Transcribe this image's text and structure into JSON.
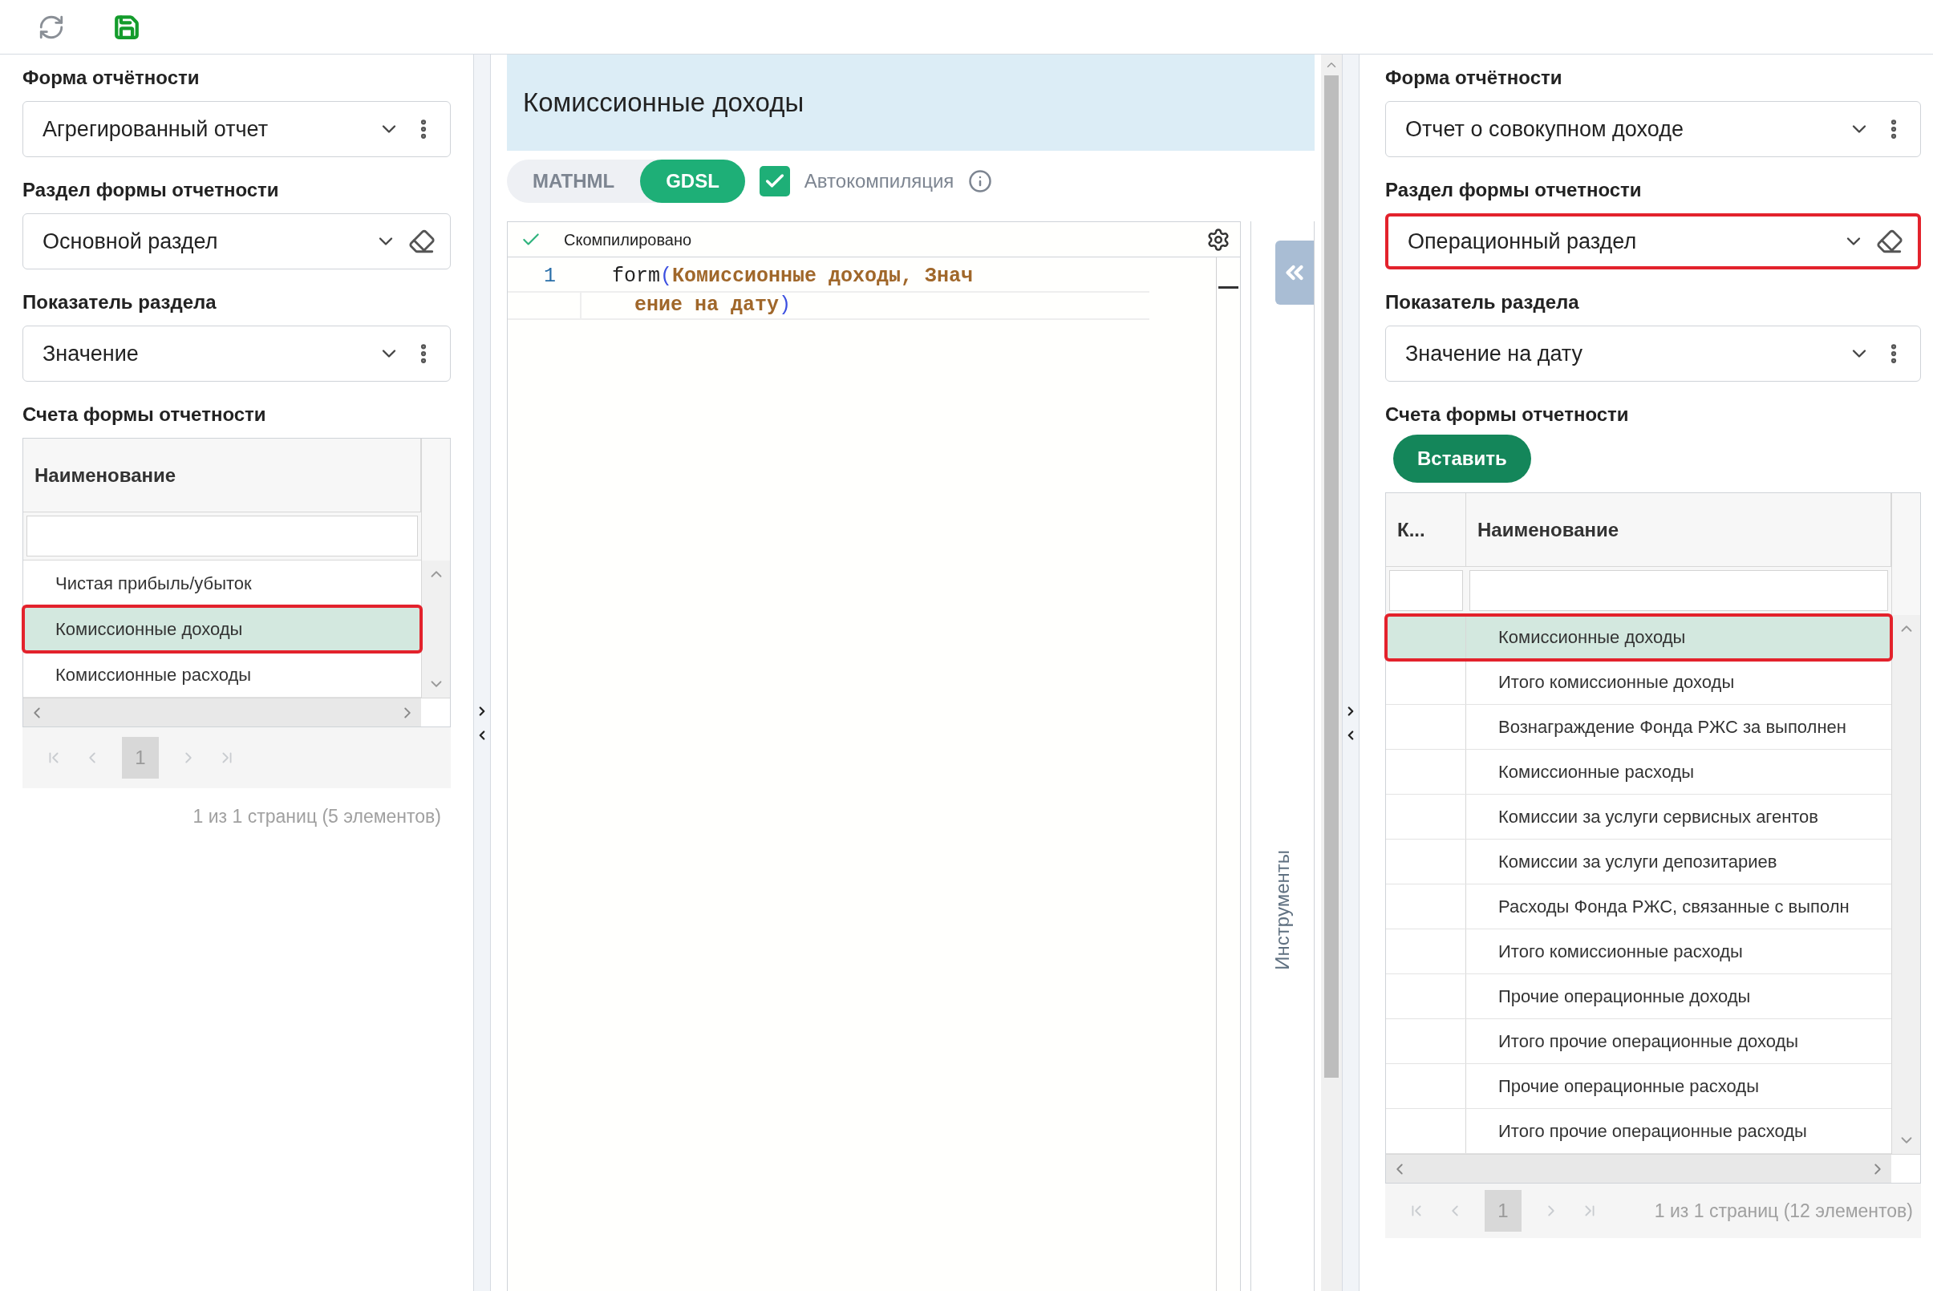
{
  "toolbar": {
    "buttons": [
      {
        "kind": "refresh"
      },
      {
        "kind": "save"
      }
    ]
  },
  "left_panel": {
    "fields": [
      {
        "label": "Форма отчётности",
        "value": "Агрегированный отчет",
        "kind": "menu",
        "highlighted": false
      },
      {
        "label": "Раздел формы отчетности",
        "value": "Основной раздел",
        "kind": "clear",
        "highlighted": false
      },
      {
        "label": "Показатель раздела",
        "value": "Значение",
        "kind": "menu",
        "highlighted": false
      }
    ],
    "accounts": {
      "label": "Счета формы отчетности",
      "columns": [
        "Наименование"
      ],
      "rows": [
        {
          "name": "Чистая прибыль/убыток",
          "selected": false,
          "highlighted": false
        },
        {
          "name": "Комиссионные доходы",
          "selected": true,
          "highlighted": true
        },
        {
          "name": "Комиссионные расходы",
          "selected": false,
          "highlighted": false
        }
      ],
      "page": "1",
      "page_info": "1 из 1 страниц (5 элементов)"
    }
  },
  "editor": {
    "title": "Комиссионные доходы",
    "tabs": [
      {
        "label": "MATHML",
        "selected": false
      },
      {
        "label": "GDSL",
        "selected": true
      }
    ],
    "autocompile": {
      "label": "Автокомпиляция",
      "checked": true
    },
    "status": "Скомпилировано",
    "lines": [
      {
        "number": "1",
        "segments": [
          {
            "text": "form",
            "kind": "function"
          },
          {
            "text": "(",
            "kind": "paren"
          },
          {
            "text": "Комиссионные доходы, Знач",
            "kind": "string"
          }
        ],
        "wrap": [
          {
            "text": "ение на дату",
            "kind": "string"
          },
          {
            "text": ")",
            "kind": "paren"
          }
        ]
      }
    ]
  },
  "tools_panel": {
    "label": "Инструменты"
  },
  "right_panel": {
    "fields": [
      {
        "label": "Форма отчётности",
        "value": "Отчет о совокупном доходе",
        "kind": "menu",
        "highlighted": false
      },
      {
        "label": "Раздел формы отчетности",
        "value": "Операционный раздел",
        "kind": "clear",
        "highlighted": true
      },
      {
        "label": "Показатель раздела",
        "value": "Значение на дату",
        "kind": "menu",
        "highlighted": false
      }
    ],
    "accounts": {
      "label": "Счета формы отчетности",
      "insert_button": "Вставить",
      "columns": [
        "К...",
        "Наименование"
      ],
      "rows": [
        {
          "name": "Комиссионные доходы",
          "selected": true,
          "highlighted": true
        },
        {
          "name": "Итого комиссионные доходы",
          "selected": false,
          "highlighted": false
        },
        {
          "name": "Вознаграждение Фонда РЖС за выполнен",
          "selected": false,
          "highlighted": false
        },
        {
          "name": "Комиссионные расходы",
          "selected": false,
          "highlighted": false
        },
        {
          "name": "Комиссии за услуги сервисных агентов",
          "selected": false,
          "highlighted": false
        },
        {
          "name": "Комиссии за услуги депозитариев",
          "selected": false,
          "highlighted": false
        },
        {
          "name": "Расходы Фонда РЖС, связанные с выполн",
          "selected": false,
          "highlighted": false
        },
        {
          "name": "Итого комиссионные расходы",
          "selected": false,
          "highlighted": false
        },
        {
          "name": "Прочие операционные доходы",
          "selected": false,
          "highlighted": false
        },
        {
          "name": "Итого прочие операционные доходы",
          "selected": false,
          "highlighted": false
        },
        {
          "name": "Прочие операционные расходы",
          "selected": false,
          "highlighted": false
        },
        {
          "name": "Итого прочие операционные расходы",
          "selected": false,
          "highlighted": false
        }
      ],
      "page": "1",
      "page_info": "1 из 1 страниц (12 элементов)"
    }
  }
}
